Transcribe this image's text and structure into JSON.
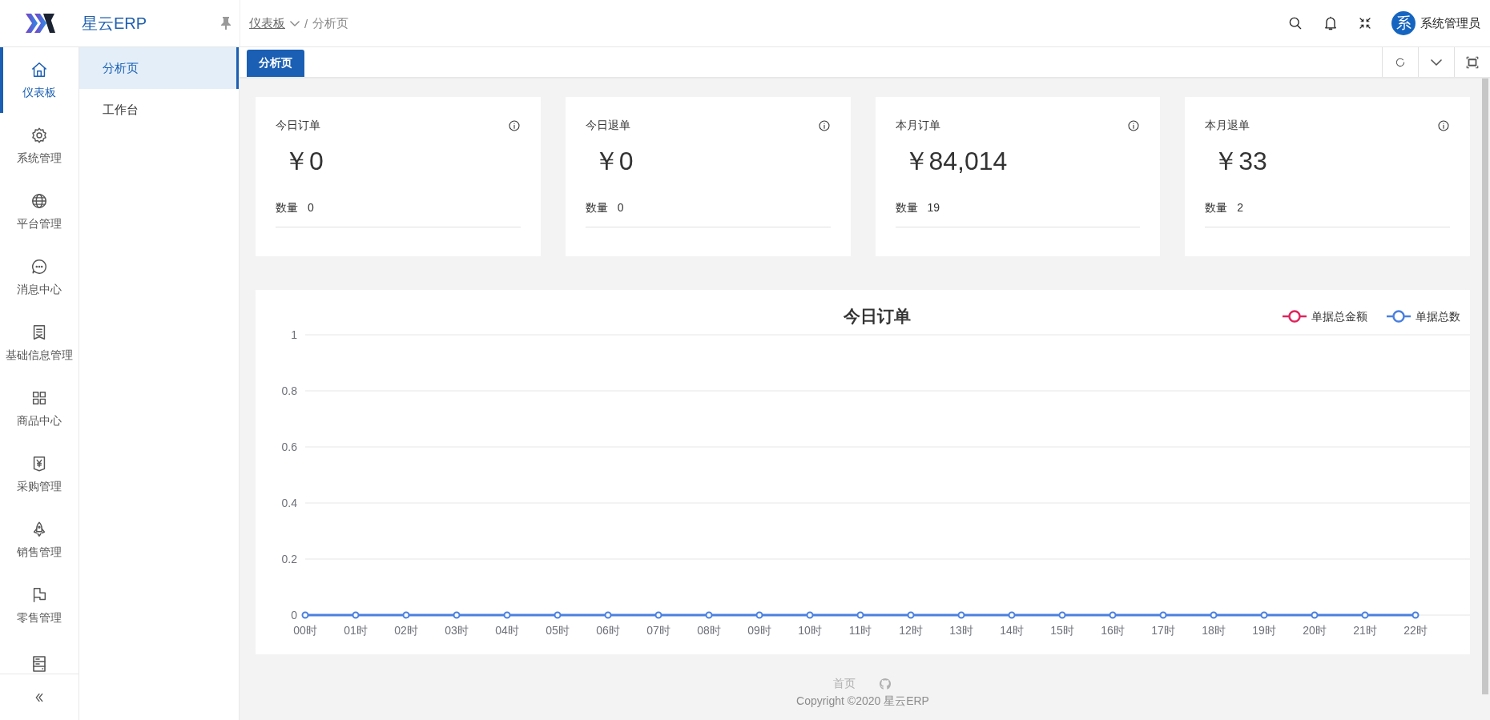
{
  "header": {
    "brand": "星云ERP",
    "breadcrumb": [
      {
        "label": "仪表板",
        "link": true
      },
      {
        "label": "分析页",
        "link": false
      }
    ],
    "separator": "/",
    "avatar": "系",
    "user": "系统管理员"
  },
  "rail": [
    {
      "label": "仪表板",
      "selected": true
    },
    {
      "label": "系统管理",
      "selected": false
    },
    {
      "label": "平台管理",
      "selected": false
    },
    {
      "label": "消息中心",
      "selected": false
    },
    {
      "label": "基础信息管理",
      "selected": false
    },
    {
      "label": "商品中心",
      "selected": false
    },
    {
      "label": "采购管理",
      "selected": false
    },
    {
      "label": "销售管理",
      "selected": false
    },
    {
      "label": "零售管理",
      "selected": false
    },
    {
      "selected": false
    }
  ],
  "submenu": [
    {
      "label": "分析页",
      "selected": true
    },
    {
      "label": "工作台",
      "selected": false
    }
  ],
  "tabs": [
    {
      "label": "分析页",
      "selected": true
    }
  ],
  "stats": [
    {
      "title": "今日订单",
      "value": "￥0",
      "count_label": "数量",
      "count": "0"
    },
    {
      "title": "今日退单",
      "value": "￥0",
      "count_label": "数量",
      "count": "0"
    },
    {
      "title": "本月订单",
      "value": "￥84,014",
      "count_label": "数量",
      "count": "19"
    },
    {
      "title": "本月退单",
      "value": "￥33",
      "count_label": "数量",
      "count": "2"
    }
  ],
  "chart": {
    "chart_data": {
      "type": "line",
      "title": "今日订单",
      "grid": true,
      "legend": true,
      "categories": [
        "00时",
        "01时",
        "02时",
        "03时",
        "04时",
        "05时",
        "06时",
        "07时",
        "08时",
        "09时",
        "10时",
        "11时",
        "12时",
        "13时",
        "14时",
        "15时",
        "16时",
        "17时",
        "18时",
        "19时",
        "20时",
        "21时",
        "22时"
      ],
      "ylim": [
        0,
        1
      ],
      "yticks": [
        0,
        0.2,
        0.4,
        0.6,
        0.8,
        1
      ],
      "series": [
        {
          "name": "单据总金额",
          "color": "#e0245e",
          "marker": "circle",
          "values": [
            null,
            null,
            null,
            null,
            null,
            null,
            null,
            null,
            null,
            null,
            null,
            null,
            null,
            null,
            null,
            null,
            null,
            null,
            null,
            null,
            null,
            null,
            null
          ]
        },
        {
          "name": "单据总数",
          "color": "#4a80e0",
          "marker": "circle",
          "values": [
            0,
            0,
            0,
            0,
            0,
            0,
            0,
            0,
            0,
            0,
            0,
            0,
            0,
            0,
            0,
            0,
            0,
            0,
            0,
            0,
            0,
            0,
            0
          ]
        }
      ]
    }
  },
  "footer": {
    "links": [
      "首页"
    ],
    "copyright": "Copyright ©2020 星云ERP"
  }
}
